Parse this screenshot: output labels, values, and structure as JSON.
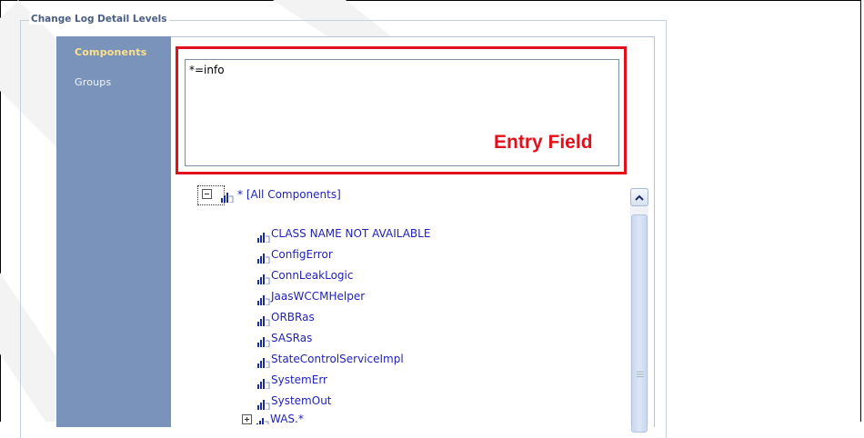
{
  "panel": {
    "title": "Change Log Detail Levels"
  },
  "nav": {
    "items": [
      {
        "label": "Components",
        "active": true
      },
      {
        "label": "Groups",
        "active": false
      }
    ]
  },
  "entry": {
    "value": "*=info",
    "callout_label": "Entry Field",
    "callout_color": "#e2101c"
  },
  "tree": {
    "root_label": "* [All Components]",
    "items": [
      "CLASS NAME NOT AVAILABLE",
      "ConfigError",
      "ConnLeakLogic",
      "JaasWCCMHelper",
      "ORBRas",
      "SASRas",
      "StateControlServiceImpl",
      "SystemErr",
      "SystemOut"
    ],
    "partial_item": "WAS.*"
  },
  "icons": {
    "collapse": "minus-box-icon",
    "expand": "plus-box-icon",
    "level": "log-level-icon",
    "scroll_up": "chevron-up-icon"
  },
  "colors": {
    "nav_bg": "#7a93bb",
    "nav_active": "#fbe28a",
    "link": "#2222b8",
    "title": "#4a5e82"
  }
}
